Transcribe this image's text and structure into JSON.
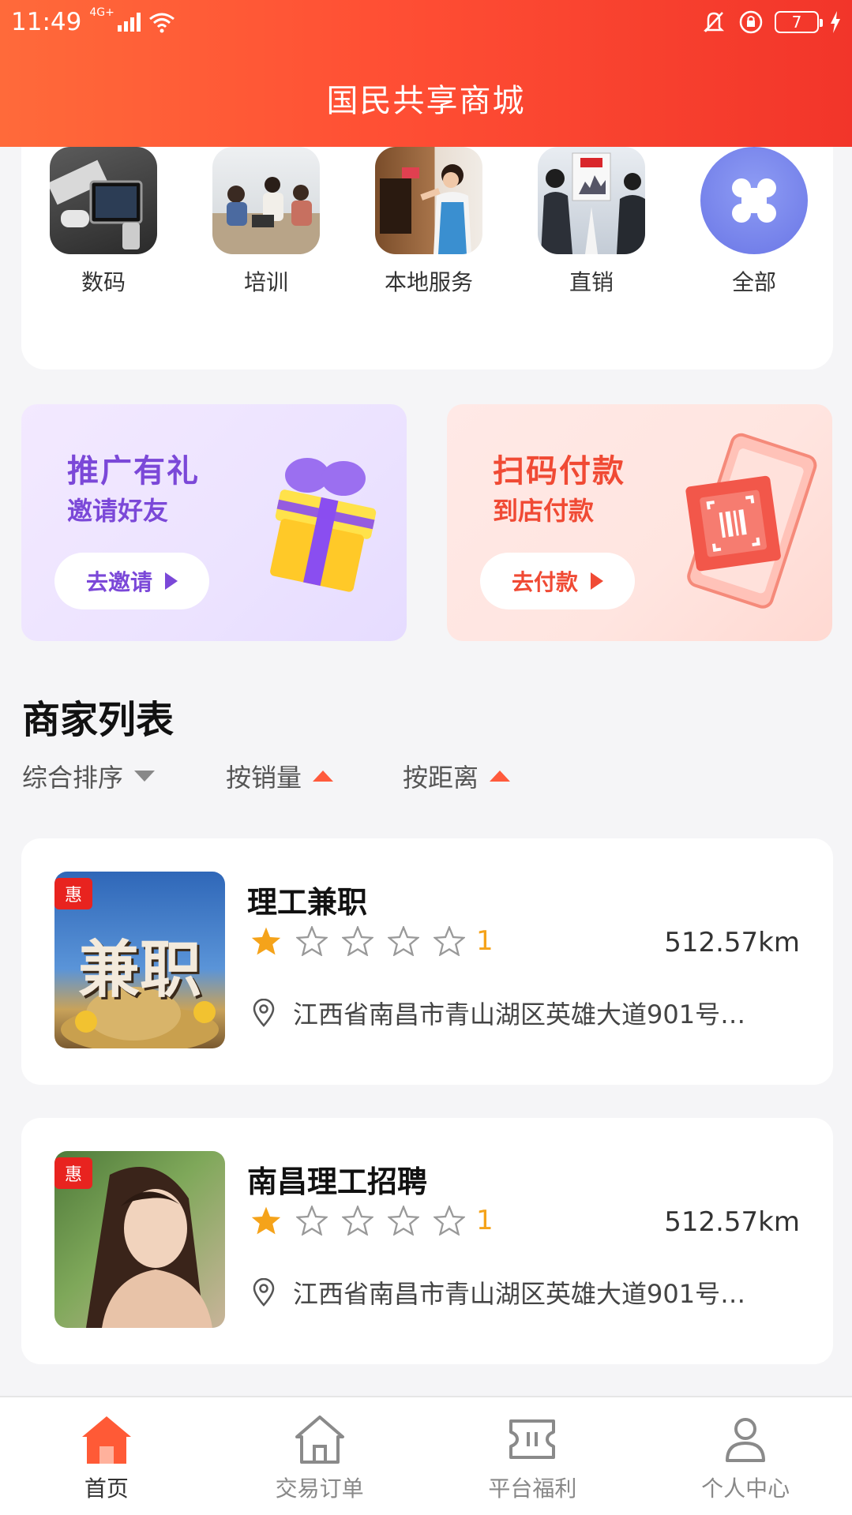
{
  "status_bar": {
    "time": "11:49",
    "network": "4G+",
    "battery": "7"
  },
  "header": {
    "title": "国民共享商城"
  },
  "categories": [
    {
      "label": "数码",
      "icon": "devices-photo"
    },
    {
      "label": "培训",
      "icon": "training-photo"
    },
    {
      "label": "本地服务",
      "icon": "cleaning-photo"
    },
    {
      "label": "直销",
      "icon": "presentation-photo"
    },
    {
      "label": "全部",
      "icon": "grid-icon"
    }
  ],
  "banners": {
    "promo": {
      "title": "推广有礼",
      "subtitle": "邀请好友",
      "button": "去邀请",
      "color": "#7b48d8"
    },
    "pay": {
      "title": "扫码付款",
      "subtitle": "到店付款",
      "button": "去付款",
      "color": "#f04a34"
    }
  },
  "merchants": {
    "title": "商家列表",
    "sort": {
      "default": "综合排序",
      "by_sales": "按销量",
      "by_distance": "按距离"
    },
    "items": [
      {
        "name": "理工兼职",
        "badge": "惠",
        "rating": 1,
        "max_rating": 5,
        "rating_text": "1",
        "distance": "512.57km",
        "address": "江西省南昌市青山湖区英雄大道901号…",
        "image_text": "兼职"
      },
      {
        "name": "南昌理工招聘",
        "badge": "惠",
        "rating": 1,
        "max_rating": 5,
        "rating_text": "1",
        "distance": "512.57km",
        "address": "江西省南昌市青山湖区英雄大道901号…"
      }
    ]
  },
  "tabbar": [
    {
      "label": "首页",
      "icon": "home-icon",
      "active": true
    },
    {
      "label": "交易订单",
      "icon": "orders-icon",
      "active": false
    },
    {
      "label": "平台福利",
      "icon": "ticket-icon",
      "active": false
    },
    {
      "label": "个人中心",
      "icon": "user-icon",
      "active": false
    }
  ],
  "colors": {
    "accent": "#ff4f34",
    "star": "#f5a31a",
    "badge": "#e8231f"
  }
}
